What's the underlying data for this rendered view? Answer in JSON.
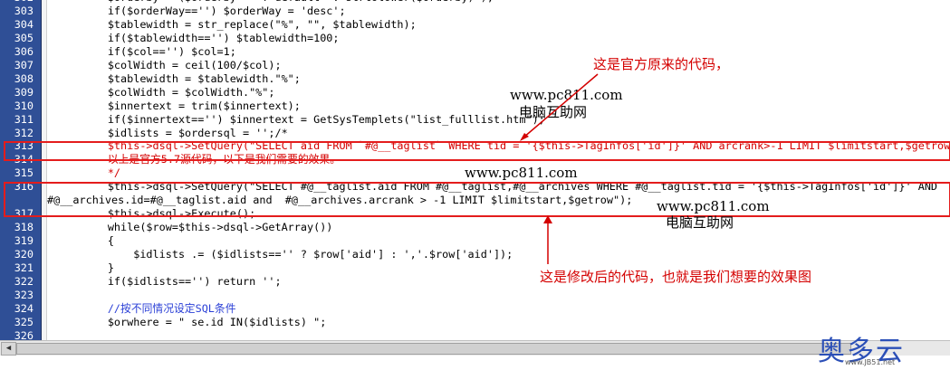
{
  "editor": {
    "lines": [
      {
        "num": "302",
        "code": "        $orderby = ($orderby==''?'default' : strtolower($orderby) );",
        "kind": "code"
      },
      {
        "num": "303",
        "code": "        if($orderWay=='') $orderWay = 'desc';",
        "kind": "code"
      },
      {
        "num": "304",
        "code": "        $tablewidth = str_replace(\"%\", \"\", $tablewidth);",
        "kind": "code"
      },
      {
        "num": "305",
        "code": "        if($tablewidth=='') $tablewidth=100;",
        "kind": "code"
      },
      {
        "num": "306",
        "code": "        if($col=='') $col=1;",
        "kind": "code"
      },
      {
        "num": "307",
        "code": "        $colWidth = ceil(100/$col);",
        "kind": "code"
      },
      {
        "num": "308",
        "code": "        $tablewidth = $tablewidth.\"%\";",
        "kind": "code"
      },
      {
        "num": "309",
        "code": "        $colWidth = $colWidth.\"%\";",
        "kind": "code"
      },
      {
        "num": "310",
        "code": "        $innertext = trim($innertext);",
        "kind": "code"
      },
      {
        "num": "311",
        "code": "        if($innertext=='') $innertext = GetSysTemplets(\"list_fulllist.htm\");",
        "kind": "code"
      },
      {
        "num": "312",
        "code": "        $idlists = $ordersql = '';/*",
        "kind": "code"
      },
      {
        "num": "313",
        "code": "        $this->dsql->SetQuery(\"SELECT aid FROM `#@__taglist` WHERE tid = '{$this->TagInfos['id']}' AND arcrank>-1 LIMIT $limitstart,$getrow\");",
        "kind": "comment-red"
      },
      {
        "num": "314",
        "code": "        以上是官方5.7源代码，以下是我们需要的效果。",
        "kind": "comment-red"
      },
      {
        "num": "315",
        "code": "        */",
        "kind": "comment-red"
      },
      {
        "num": "316",
        "code": "        $this->dsql->SetQuery(\"SELECT #@__taglist.aid FROM #@__taglist,#@__archives WHERE #@__taglist.tid = '{$this->TagInfos['id']}' AND",
        "kind": "code"
      },
      {
        "num": "",
        "code": "#@__archives.id=#@__taglist.aid and  #@__archives.arcrank > -1 LIMIT $limitstart,$getrow\");",
        "kind": "wrap"
      },
      {
        "num": "317",
        "code": "        $this->dsql->Execute();",
        "kind": "code"
      },
      {
        "num": "318",
        "code": "        while($row=$this->dsql->GetArray())",
        "kind": "code"
      },
      {
        "num": "319",
        "code": "        {",
        "kind": "code"
      },
      {
        "num": "320",
        "code": "            $idlists .= ($idlists=='' ? $row['aid'] : ','.$row['aid']);",
        "kind": "code"
      },
      {
        "num": "321",
        "code": "        }",
        "kind": "code"
      },
      {
        "num": "322",
        "code": "        if($idlists=='') return '';",
        "kind": "code"
      },
      {
        "num": "323",
        "code": "",
        "kind": "code"
      },
      {
        "num": "324",
        "code": "        //按不同情况设定SQL条件",
        "kind": "comment-blue"
      },
      {
        "num": "325",
        "code": "        $orwhere = \" se.id IN($idlists) \";",
        "kind": "code"
      },
      {
        "num": "326",
        "code": "",
        "kind": "code"
      }
    ]
  },
  "annotations": {
    "top_note": "这是官方原来的代码，",
    "url1": "www.pc811.com",
    "site1": "电脑互助网",
    "url2": "www.pc811.com",
    "url3": "www.pc811.com",
    "site2": "电脑互助网",
    "bottom_note": "这是修改后的代码，也就是我们想要的效果图"
  },
  "watermark": {
    "logo_text": "奥多云",
    "domain": "www.JB51.net"
  },
  "colors": {
    "gutter": "#2f4f96",
    "box": "#e41c1c",
    "keyword": "#2a3fd6",
    "red": "#d40000"
  }
}
